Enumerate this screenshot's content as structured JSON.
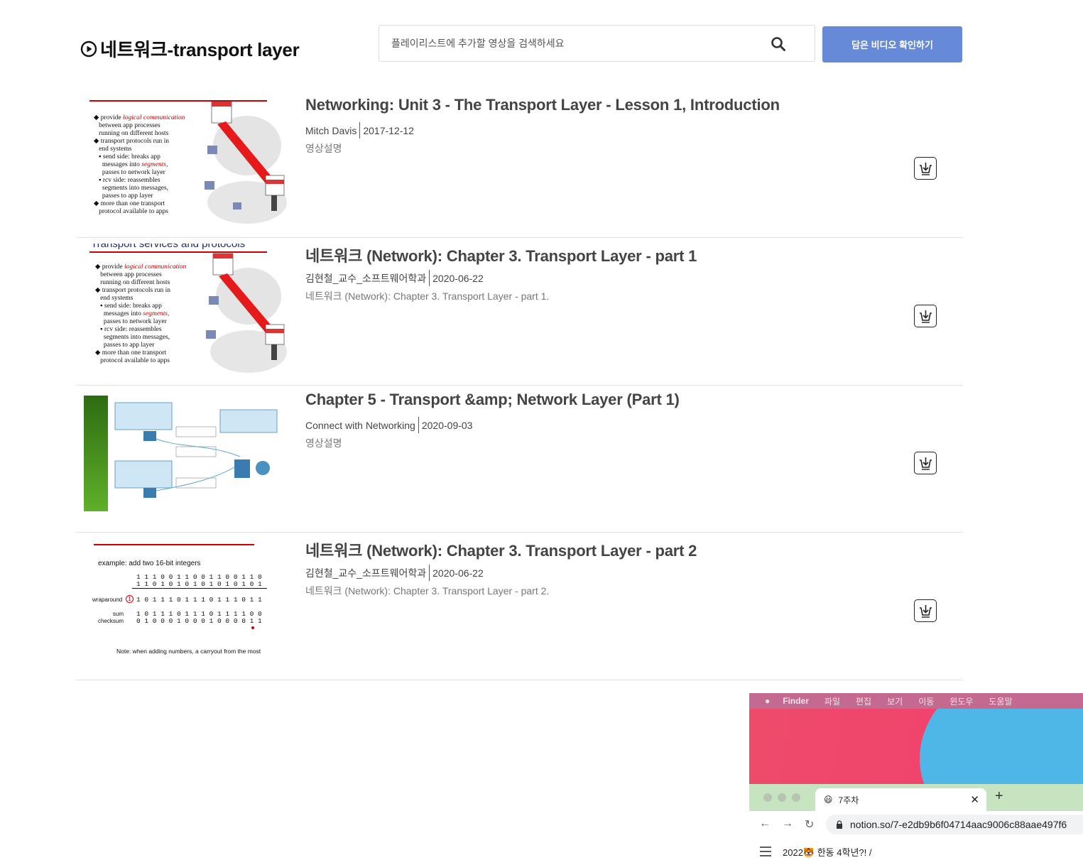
{
  "header": {
    "title": "네트워크-transport layer",
    "search_placeholder": "플레이리스트에 추가할 영상을 검색하세요",
    "saved_button": "담은 비디오 확인하기"
  },
  "videos": [
    {
      "title": "Networking: Unit 3 - The Transport Layer - Lesson 1, Introduction",
      "channel": "Mitch Davis",
      "date": "2017-12-12",
      "description": "영상설명"
    },
    {
      "title": "네트워크 (Network): Chapter 3. Transport Layer - part 1",
      "channel": "김현철_교수_소프트웨어학과",
      "date": "2020-06-22",
      "description": "네트워크 (Network): Chapter 3. Transport Layer - part 1."
    },
    {
      "title": "Chapter 5 - Transport &amp; Network Layer (Part 1)",
      "channel": "Connect with Networking",
      "date": "2020-09-03",
      "description": "영상설명"
    },
    {
      "title": "네트워크 (Network): Chapter 3. Transport Layer - part 2",
      "channel": "김현철_교수_소프트웨어학과",
      "date": "2020-06-22",
      "description": "네트워크 (Network): Chapter 3. Transport Layer - part 2."
    }
  ],
  "thumb_text": {
    "slide_head_1": "Transport services and protocols",
    "bullets": [
      "provide",
      "logical communication",
      "between app processes",
      "running on different hosts",
      "transport protocols run in",
      "end systems",
      "send side: breaks app",
      "messages into",
      "segments,",
      "passes to network layer",
      "rcv side: reassembles",
      "segments into messages,",
      "passes to app layer",
      "more than one transport",
      "protocol available to apps"
    ],
    "checksum_example": "example: add two 16-bit integers",
    "checksum_rows": [
      "1 1 1 0 0 1 1 0 0 1 1 0 0 1 1 0",
      "1 1 0 1 0 1 0 1 0 1 0 1 0 1 0 1",
      "1 0 1 1 1 0 1 1 1 0 1 1 1 0 1 1",
      "1 0 1 1 1 0 1 1 1 0 1 1 1 1 0 0",
      "0 1 0 0 0 1 0 0 0 1 0 0 0 0 1 1"
    ],
    "wraparound_label": "wraparound",
    "wraparound_digit": "1",
    "sum_label": "sum",
    "checksum_label": "checksum",
    "note": "Note: when adding numbers, a carryout from the most"
  },
  "mac": {
    "menu": [
      "Finder",
      "파일",
      "편집",
      "보기",
      "이동",
      "윈도우",
      "도움말"
    ],
    "tab_title": "7주차",
    "url": "notion.so/7-e2db9b6f04714aac9006c88aae497f6",
    "bookmark": "2022🐯 한동 4학년?! /"
  },
  "colors": {
    "accent": "#6689d8",
    "slide_red": "#cc0000",
    "thumb_green": "#4a9a1f"
  }
}
